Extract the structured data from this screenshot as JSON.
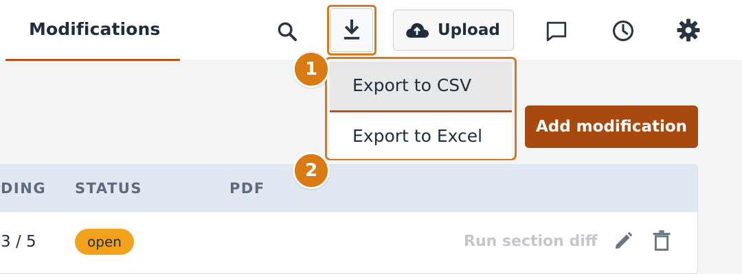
{
  "header": {
    "active_tab": "Modifications",
    "upload_label": "Upload",
    "icons": [
      "search-icon",
      "download-icon",
      "cloud-upload-icon",
      "comment-icon",
      "history-icon",
      "settings-icon"
    ]
  },
  "export_menu": {
    "items": [
      {
        "label": "Export to CSV",
        "step": "1"
      },
      {
        "label": "Export to Excel",
        "step": "2"
      }
    ]
  },
  "actions": {
    "add_label": "Add modification"
  },
  "table": {
    "columns": [
      "DING",
      "STATUS",
      "PDF"
    ],
    "rows": [
      {
        "progress": "3 / 5",
        "status": "open",
        "action_label": "Run section diff"
      }
    ]
  },
  "colors": {
    "accent": "#b6531a",
    "highlight": "#d27a1c",
    "badge": "#d97a14",
    "status_open": "#f2a11a",
    "primary_button": "#a8490f"
  }
}
